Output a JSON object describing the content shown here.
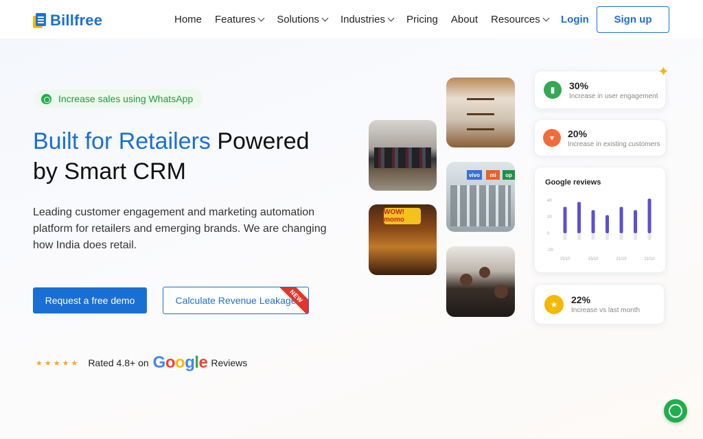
{
  "brand": {
    "name": "Billfree"
  },
  "nav": {
    "items": [
      {
        "label": "Home",
        "dropdown": false
      },
      {
        "label": "Features",
        "dropdown": true
      },
      {
        "label": "Solutions",
        "dropdown": true
      },
      {
        "label": "Industries",
        "dropdown": true
      },
      {
        "label": "Pricing",
        "dropdown": false
      },
      {
        "label": "About",
        "dropdown": false
      },
      {
        "label": "Resources",
        "dropdown": true
      }
    ],
    "login": "Login",
    "signup": "Sign up"
  },
  "hero": {
    "pill": "Increase sales using WhatsApp",
    "headline_blue": "Built for Retailers",
    "headline_rest_1": " Powered",
    "headline_rest_2": "by Smart CRM",
    "subtext": "Leading customer engagement and marketing automation platform for retailers and emerging brands. We are changing how India does retail.",
    "demo_button": "Request a free demo",
    "calc_button": "Calculate Revenue Leakage",
    "new_badge": "NEW",
    "rating_prefix": "Rated 4.8+ on",
    "rating_suffix": "Reviews",
    "google": [
      "G",
      "o",
      "o",
      "g",
      "l",
      "e"
    ]
  },
  "photos": {
    "store_sign": "WOW! momo",
    "phone_brands": [
      "vivo",
      "mi",
      "op"
    ]
  },
  "stats": [
    {
      "value": "30%",
      "label": "Increase in user engagement",
      "color": "#34a853",
      "icon": "bar-chart-icon"
    },
    {
      "value": "20%",
      "label": "Increase in existing customers",
      "color": "#f26b3a",
      "icon": "cart-icon"
    },
    {
      "value": "22%",
      "label": "Increase vs last month",
      "color": "#f5b800",
      "icon": "star-icon"
    }
  ],
  "chart_data": {
    "type": "bar",
    "title": "Google reviews",
    "categories": [
      "15/10",
      "",
      "15/10",
      "",
      "21/10",
      "",
      "31/10"
    ],
    "values": [
      32,
      38,
      28,
      22,
      32,
      28,
      42
    ],
    "yticks": [
      40,
      20,
      0,
      -20
    ],
    "ylim": [
      -20,
      40
    ],
    "bar_color": "#5b4fd6",
    "grid": false
  },
  "colors": {
    "accent": "#1a6fd4",
    "whatsapp": "#1fae4b"
  }
}
